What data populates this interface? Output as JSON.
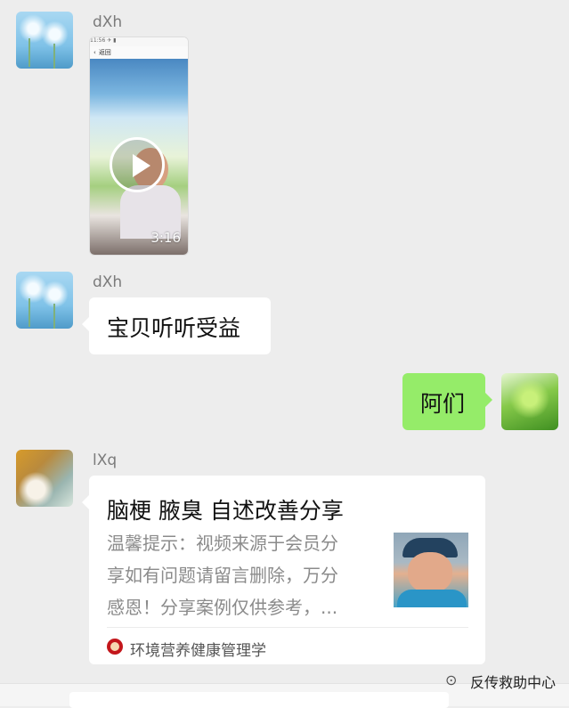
{
  "chat": {
    "messages": [
      {
        "sender": "dXh",
        "side": "left",
        "type": "video",
        "video": {
          "duration": "3:16",
          "inner_status": "11:56 ✈ ▮",
          "inner_back": "返回",
          "inner_icon": "play-circle-icon"
        }
      },
      {
        "sender": "dXh",
        "side": "left",
        "type": "text",
        "text": "宝贝听听受益"
      },
      {
        "side": "right",
        "type": "text",
        "text": "阿们"
      },
      {
        "sender": "lXq",
        "side": "left",
        "type": "link",
        "link": {
          "title": "脑梗 腋臭 自述改善分享",
          "description_lines": [
            "温馨提示：视频来源于会员分",
            "享如有问题请留言删除，万分",
            "感恩！分享案例仅供参考，..."
          ],
          "source": "环境营养健康管理学"
        }
      }
    ]
  },
  "watermark": {
    "icon": "wechat-channel-icon",
    "text": "反传救助中心"
  },
  "colors": {
    "background": "#ededed",
    "bubble_white": "#ffffff",
    "bubble_green": "#95ec69",
    "sender_name": "#7b7b7b"
  }
}
